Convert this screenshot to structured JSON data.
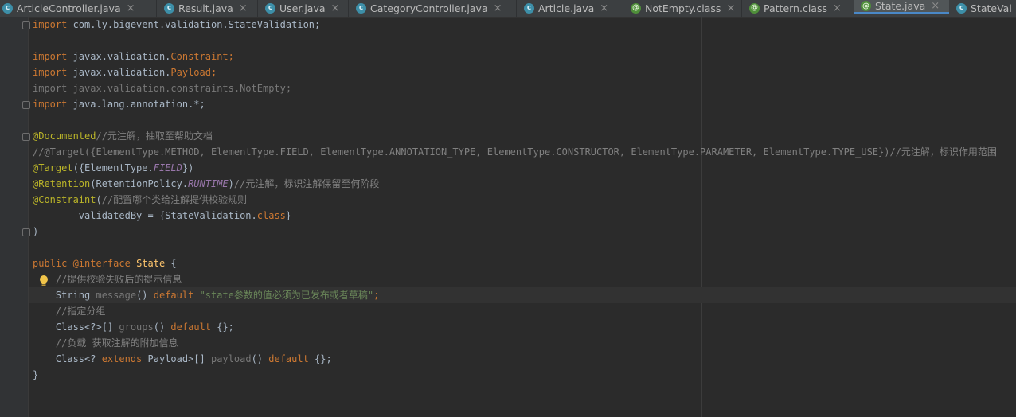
{
  "tabs": [
    {
      "label": "ArticleController.java",
      "icon": "class-icon",
      "active": false
    },
    {
      "label": "Result.java",
      "icon": "class-icon",
      "active": false
    },
    {
      "label": "User.java",
      "icon": "class-icon",
      "active": false
    },
    {
      "label": "CategoryController.java",
      "icon": "class-icon",
      "active": false
    },
    {
      "label": "Article.java",
      "icon": "class-icon",
      "active": false
    },
    {
      "label": "NotEmpty.class",
      "icon": "annotation-icon",
      "active": false
    },
    {
      "label": "Pattern.class",
      "icon": "annotation-icon",
      "active": false
    },
    {
      "label": "State.java",
      "icon": "annotation-icon",
      "active": true
    },
    {
      "label": "StateVal",
      "icon": "class-icon",
      "active": false
    }
  ],
  "icon_glyphs": {
    "class": "c",
    "annotation": "@"
  },
  "close_glyph": "×",
  "code": {
    "l1": {
      "kw": "import",
      "rest": " com.ly.bigevent.validation.StateValidation;"
    },
    "l3": {
      "kw": "import",
      "rest": " javax.validation.",
      "cls": "Constraint",
      "end": ";"
    },
    "l4": {
      "kw": "import",
      "rest": " javax.validation.",
      "cls": "Payload",
      "end": ";"
    },
    "l5": {
      "text": "import javax.validation.constraints.NotEmpty;"
    },
    "l6": {
      "kw": "import",
      "rest": " java.lang.annotation.*;"
    },
    "l8": {
      "ann": "@Documented",
      "cm": "//元注解，抽取至帮助文档"
    },
    "l9": {
      "cm": "//@Target({ElementType.METHOD, ElementType.FIELD, ElementType.ANNOTATION_TYPE, ElementType.CONSTRUCTOR, ElementType.PARAMETER, ElementType.TYPE_USE})//元注解，标识作用范围"
    },
    "l10": {
      "ann": "@Target",
      "a": "({ElementType.",
      "fi": "FIELD",
      "b": "})"
    },
    "l11": {
      "ann": "@Retention",
      "a": "(RetentionPolicy.",
      "fi": "RUNTIME",
      "b": ")",
      "cm": "//元注解，标识注解保留至何阶段"
    },
    "l12": {
      "ann": "@Constraint",
      "a": "(",
      "cm": "//配置哪个类给注解提供校验规则"
    },
    "l13": {
      "a": "        validatedBy = {StateValidation.",
      "kw": "class",
      "b": "}"
    },
    "l14": {
      "a": ")"
    },
    "l16": {
      "kw1": "public",
      "kw2": " @interface",
      "name": " State",
      "b": " {"
    },
    "l17": {
      "cm": "    //提供校验失败后的提示信息"
    },
    "l18": {
      "a": "    String ",
      "m": "message",
      "b": "() ",
      "kw": "default",
      "c": " ",
      "st": "\"state参数的值必须为已发布或者草稿\"",
      "d": ";"
    },
    "l19": {
      "cm": "    //指定分组"
    },
    "l20": {
      "a": "    Class<?>[] ",
      "m": "groups",
      "b": "() ",
      "kw": "default",
      "c": " {};"
    },
    "l21": {
      "cm": "    //负载 获取注解的附加信息"
    },
    "l22": {
      "a": "    Class<? ",
      "kw1": "extends",
      "b": " Payload>[] ",
      "m": "payload",
      "c": "() ",
      "kw2": "default",
      "d": " {};"
    },
    "l23": {
      "a": "}"
    }
  }
}
